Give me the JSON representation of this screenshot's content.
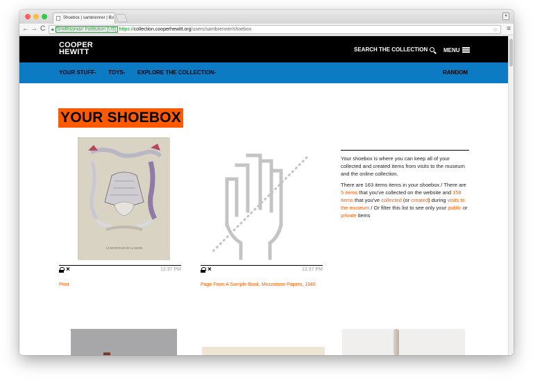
{
  "browser": {
    "tab_title": "Shoebox | sambrenner | Co",
    "tab_close": "×",
    "address": {
      "ev_label": "Smithsonian Institution [US]",
      "scheme": "https://",
      "host": "collection.cooperhewitt.org",
      "path": "/users/sambrenner/shoebox"
    }
  },
  "site": {
    "logo_line1": "COOPER",
    "logo_line2": "HEWITT",
    "search_label": "SEARCH THE COLLECTION",
    "menu_label": "MENU",
    "nav": {
      "your_stuff": "YOUR STUFF",
      "toys": "TOYS",
      "explore": "EXPLORE THE COLLECTION",
      "random": "RANDOM"
    }
  },
  "page": {
    "title": "YOUR SHOEBOX",
    "cards": [
      {
        "time": "12:37 PM",
        "title": "Print",
        "remove": "×"
      },
      {
        "time": "12:37 PM",
        "title": "Page From A Sample Book, Mezzotone Papers, 1948",
        "remove": "×"
      }
    ],
    "print_caption": "LE MONITEUR DE LA MODE",
    "sidebar": {
      "intro": "Your shoebox is where you can keep all of your collected and created items from visits to the museum and the online collection.",
      "s1": "There are 163 items items in your shoebox / There are ",
      "link_items5": "5 items",
      "s2": " that you've collected on the website and ",
      "link_items158": "158 items",
      "s3": " that you've ",
      "link_collected": "collected",
      "s4": " (or ",
      "link_created": "created",
      "s5": ") during ",
      "link_visits": "visits to the museum",
      "s6": " / Or filter this list to see only your ",
      "link_public": "public",
      "s7": " or ",
      "link_private": "private",
      "s8": " items"
    }
  },
  "colors": {
    "accent": "#ff5a00",
    "nav_blue": "#0d7ac4",
    "header_black": "#000000"
  }
}
